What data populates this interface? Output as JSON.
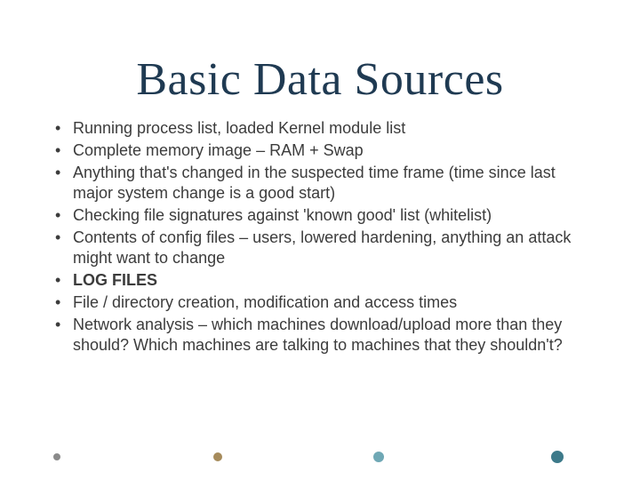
{
  "slide": {
    "title": "Basic Data Sources",
    "bullets": [
      {
        "text": "Running process list, loaded Kernel module list",
        "bold": false
      },
      {
        "text": "Complete memory image – RAM + Swap",
        "bold": false
      },
      {
        "text": "Anything that's changed in the suspected time frame (time since last major system change is a good start)",
        "bold": false
      },
      {
        "text": "Checking file signatures against 'known good' list (whitelist)",
        "bold": false
      },
      {
        "text": "Contents of config files – users, lowered hardening, anything an attack might want to change",
        "bold": false
      },
      {
        "text": "LOG FILES",
        "bold": true
      },
      {
        "text": "File / directory creation, modification and access times",
        "bold": false
      },
      {
        "text": "Network analysis – which machines download/upload more than they should? Which machines are talking to machines that they shouldn't?",
        "bold": false
      }
    ]
  }
}
